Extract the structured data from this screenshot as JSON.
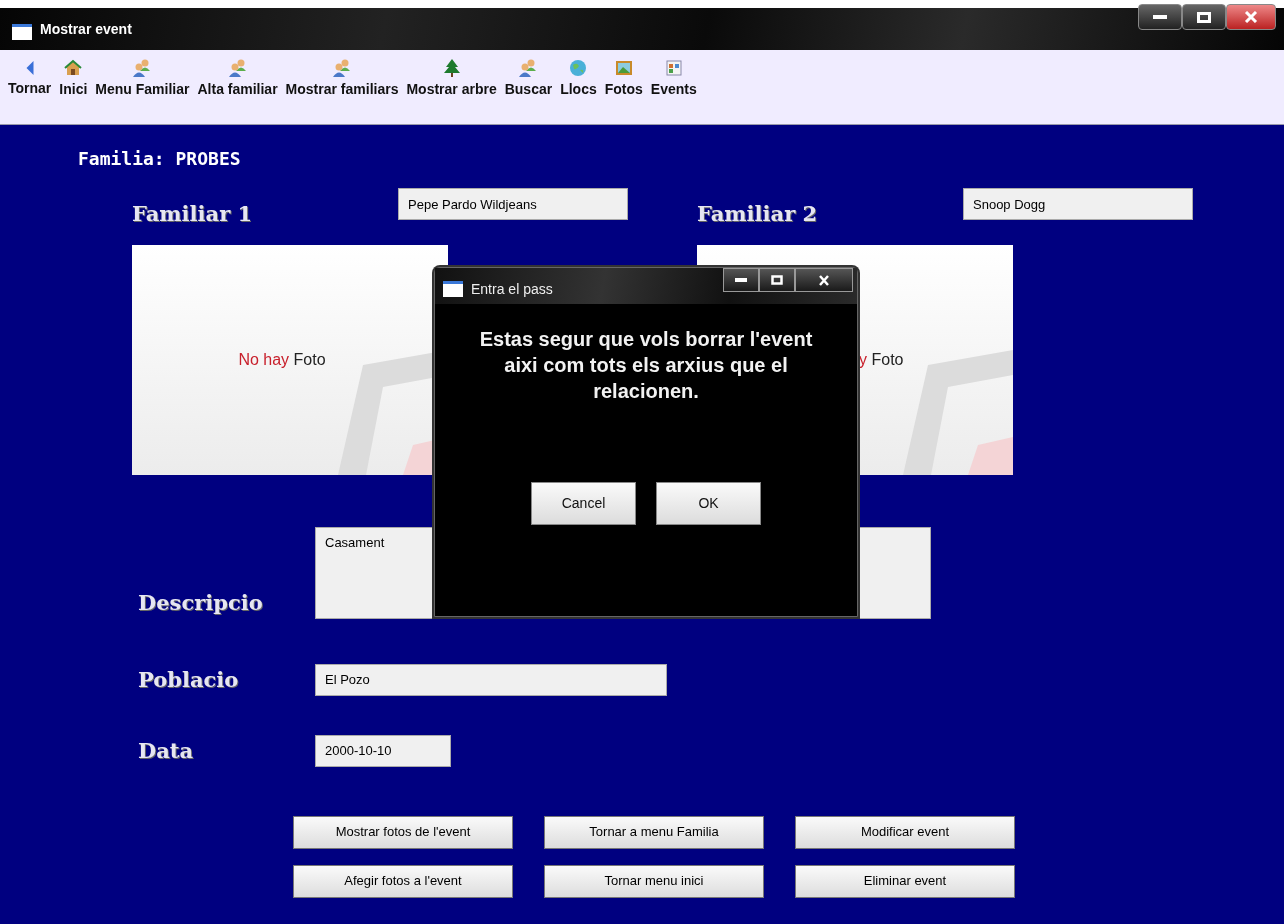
{
  "window": {
    "title": "Mostrar event"
  },
  "toolbar": [
    {
      "label": "Tornar",
      "kind": "back"
    },
    {
      "label": "Inici",
      "kind": "home"
    },
    {
      "label": "Menu Familiar",
      "kind": "people"
    },
    {
      "label": "Alta familiar",
      "kind": "people"
    },
    {
      "label": "Mostrar familiars",
      "kind": "people"
    },
    {
      "label": "Mostrar arbre",
      "kind": "tree"
    },
    {
      "label": "Buscar",
      "kind": "people"
    },
    {
      "label": "Llocs",
      "kind": "globe"
    },
    {
      "label": "Fotos",
      "kind": "picture"
    },
    {
      "label": "Events",
      "kind": "calendar"
    }
  ],
  "family": {
    "label": "Familia: PROBES"
  },
  "members": [
    {
      "label": "Familiar 1",
      "name": "Pepe Pardo Wildjeans",
      "photo": {
        "missing_text": "No hay",
        "photo_text": "Foto"
      }
    },
    {
      "label": "Familiar 2",
      "name": "Snoop Dogg",
      "photo": {
        "missing_text": "y",
        "photo_text": "Foto"
      }
    }
  ],
  "fields": [
    {
      "label": "Descripcio",
      "value": "Casament",
      "kind": "area"
    },
    {
      "label": "Poblacio",
      "value": "El Pozo",
      "kind": "line"
    },
    {
      "label": "Data",
      "value": "2000-10-10",
      "kind": "short"
    }
  ],
  "buttons": [
    [
      "Mostrar fotos de l'event",
      "Tornar a menu Familia",
      "Modificar event"
    ],
    [
      "Afegir fotos a l'event",
      "Tornar menu inici",
      "Eliminar event"
    ]
  ],
  "dialog": {
    "title": "Entra el pass",
    "message": "Estas segur que vols borrar l'event aixi com tots els arxius que el relacionen.",
    "buttons": [
      "Cancel",
      "OK"
    ]
  }
}
